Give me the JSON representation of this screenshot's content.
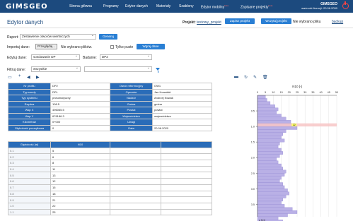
{
  "app": {
    "logo": "GIMSGEO",
    "page_title": "Edytor danych"
  },
  "nav": [
    {
      "label": "Strona główna"
    },
    {
      "label": "Programy"
    },
    {
      "label": "Edytor danych"
    },
    {
      "label": "Materiały"
    },
    {
      "label": "Szablony"
    },
    {
      "label": "Edytor mobilny",
      "badge": "beta"
    },
    {
      "label": "Zapisane projekty",
      "badge": "beta"
    }
  ],
  "user": {
    "name": "GIMSGEO",
    "license": "ważność licencji: 20.06.2030"
  },
  "project": {
    "label": "Projekt:",
    "name": "testowy_projekt",
    "save": "Zapisz projekt",
    "load": "Wczytaj projekt",
    "no_file": "Nie wybrano pliku",
    "backup": "backup"
  },
  "report": {
    "label": "Raport:",
    "value": "Zestawienie otworów wiertniczych",
    "generate": "Generuj"
  },
  "import": {
    "label": "Importuj dane:",
    "browse": "Przeglądaj...",
    "no_files": "Nie wybrano plików.",
    "only_empty": "Tylko puste",
    "load": "Wgraj dane"
  },
  "edit": {
    "label": "Edytuj dane:",
    "value": "sondowanie DP",
    "study_label": "Badanie:",
    "study_value": "DP2"
  },
  "filter": {
    "label": "Filtruj dane:",
    "value": "wszystkie",
    "value2": ""
  },
  "icons": [
    "file-icon",
    "plus-icon",
    "arrow-left-icon",
    "arrow-right-icon"
  ],
  "form_left": [
    {
      "k": "Nr profilu",
      "v": "DP2"
    },
    {
      "k": "Typ sondy",
      "v": "DPL"
    },
    {
      "k": "Typ systemu",
      "v": "pneumatyczny"
    },
    {
      "k": "Rzędna",
      "v": "108.5"
    },
    {
      "k": "Wsp X",
      "v": "496065.5"
    },
    {
      "k": "Wsp Y",
      "v": "676186.3"
    },
    {
      "k": "Kilometraż",
      "v": "0+000"
    },
    {
      "k": "Głębokość początkowa",
      "v": "0"
    }
  ],
  "form_right": [
    {
      "k": "Otwór referencyjny",
      "v": "OW1"
    },
    {
      "k": "Operator",
      "v": "Jan Kowalski"
    },
    {
      "k": "Nadzór",
      "v": "Andrzej Nowak"
    },
    {
      "k": "Gmina",
      "v": "gmina"
    },
    {
      "k": "Powiat",
      "v": "powiat"
    },
    {
      "k": "Województwo",
      "v": "województwo"
    },
    {
      "k": "Uwagi",
      "v": ""
    },
    {
      "k": "Data",
      "v": "20.06.2020"
    }
  ],
  "table": {
    "headers": [
      "Głębokość [m]",
      "N10"
    ],
    "rows": [
      [
        "0.1",
        "5"
      ],
      [
        "0.2",
        "6"
      ],
      [
        "0.3",
        "8"
      ],
      [
        "0.4",
        "11"
      ],
      [
        "0.5",
        "13"
      ],
      [
        "0.6",
        "12"
      ],
      [
        "0.7",
        "15"
      ],
      [
        "0.8",
        "18"
      ],
      [
        "0.9",
        "21"
      ],
      [
        "1.0",
        "22"
      ],
      [
        "1.1",
        "25"
      ]
    ]
  },
  "chart_data": {
    "type": "bar",
    "orientation": "horizontal",
    "title": "N10 [-]",
    "ylabel": "z [m]",
    "xticks": [
      "0",
      "5",
      "10",
      "15",
      "20",
      "25",
      "30",
      "35",
      "40",
      "45",
      "50"
    ],
    "yticks": [
      "0.5",
      "1.0",
      "1.5",
      "2.0",
      "2.5",
      "3.0",
      "3.5"
    ],
    "xlim": [
      0,
      50
    ],
    "ylim": [
      0,
      3.9
    ],
    "highlight": {
      "z": 1.0,
      "value": 22
    },
    "depth_step": 0.1,
    "values": [
      5,
      6,
      8,
      11,
      13,
      12,
      15,
      18,
      21,
      22,
      25,
      18,
      16,
      15,
      17,
      14,
      13,
      15,
      16,
      14,
      12,
      13,
      15,
      16,
      18,
      17,
      15,
      14,
      16,
      17,
      19,
      20,
      18,
      16,
      15,
      17,
      22,
      25,
      19,
      13,
      16
    ],
    "colors": {
      "bar": "#b9b0e6",
      "highlight": "#f7c6c6",
      "label": "#ffff66"
    }
  },
  "colors": {
    "topbar": "#1c4a7e",
    "accent": "#2a7fd4",
    "header_cell": "#2a6cb8"
  }
}
